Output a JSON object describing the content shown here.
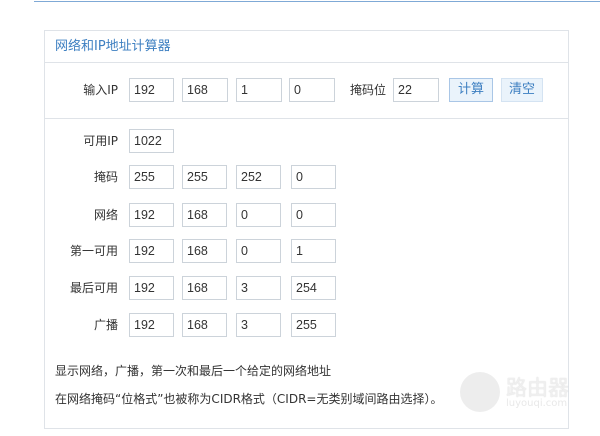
{
  "title": "网络和IP地址计算器",
  "input": {
    "label": "输入IP",
    "octets": [
      "192",
      "168",
      "1",
      "0"
    ],
    "mask_label": "掩码位",
    "mask_bits": "22",
    "calc_button": "计算",
    "clear_button": "清空"
  },
  "results": [
    {
      "label": "可用IP",
      "values": [
        "1022"
      ]
    },
    {
      "label": "掩码",
      "values": [
        "255",
        "255",
        "252",
        "0"
      ]
    },
    {
      "label": "网络",
      "values": [
        "192",
        "168",
        "0",
        "0"
      ]
    },
    {
      "label": "第一可用",
      "values": [
        "192",
        "168",
        "0",
        "1"
      ]
    },
    {
      "label": "最后可用",
      "values": [
        "192",
        "168",
        "3",
        "254"
      ]
    },
    {
      "label": "广播",
      "values": [
        "192",
        "168",
        "3",
        "255"
      ]
    }
  ],
  "notes": [
    "显示网络，广播，第一次和最后一个给定的网络地址",
    "在网络掩码“位格式”也被称为CIDR格式（CIDR=无类别域间路由选择）。"
  ],
  "watermark": {
    "name": "路由器",
    "url": "luyouqi.com"
  }
}
